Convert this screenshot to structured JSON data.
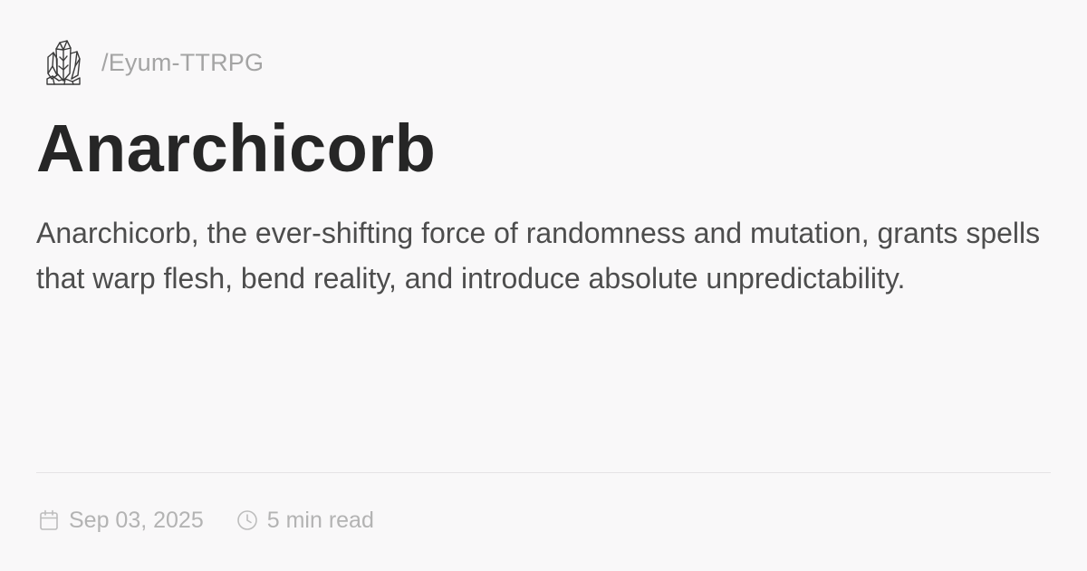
{
  "header": {
    "site_name": "/Eyum-TTRPG",
    "logo_icon": "crystal-cluster-icon"
  },
  "main": {
    "title": "Anarchicorb",
    "description": "Anarchicorb, the ever-shifting force of randomness and mutation, grants spells that warp flesh, bend reality, and introduce absolute unpredictability."
  },
  "meta": {
    "date": "Sep 03, 2025",
    "date_icon": "calendar-icon",
    "read_time": "5 min read",
    "read_time_icon": "clock-icon"
  },
  "colors": {
    "background": "#f9f8f9",
    "title": "#262626",
    "body_text": "#4d4d4d",
    "muted_text": "#a4a4a4",
    "divider": "#e5e3e5"
  }
}
